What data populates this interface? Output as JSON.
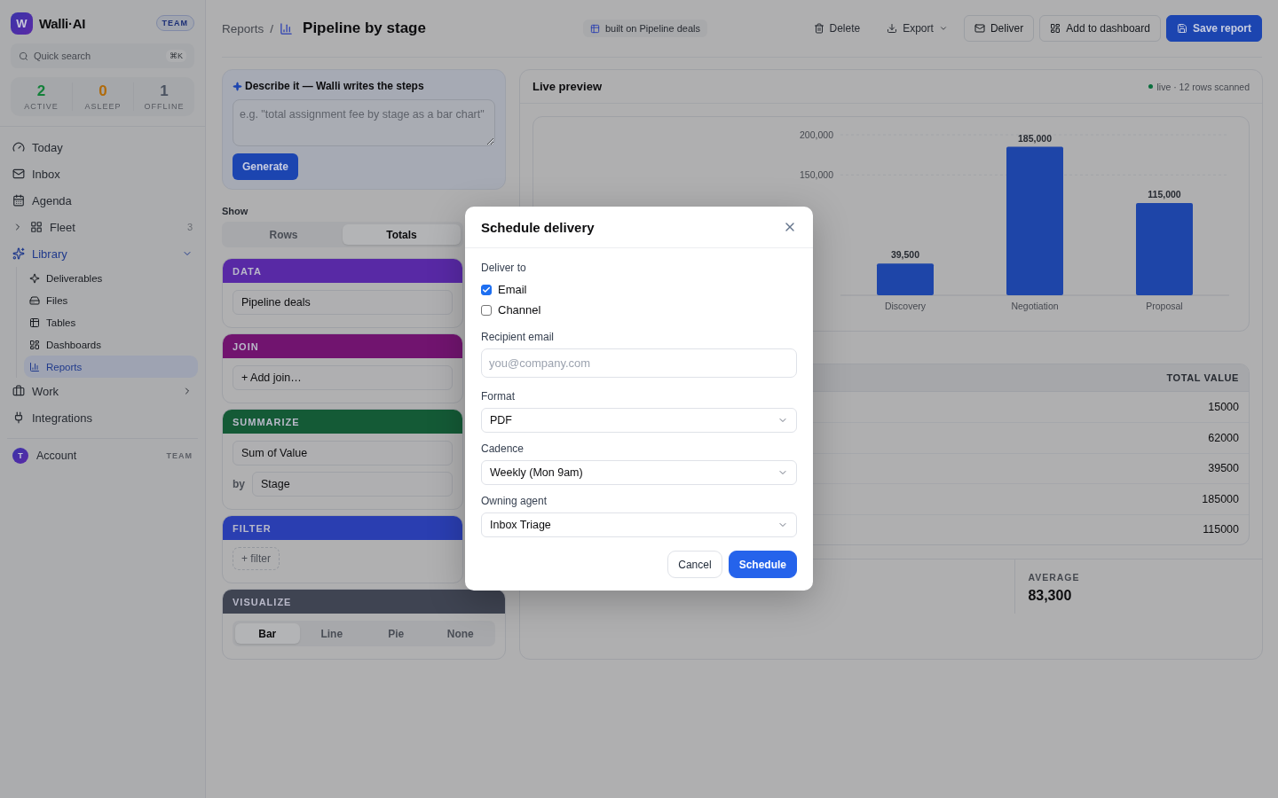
{
  "sidebar": {
    "brand": {
      "initial": "W",
      "name": "Walli·AI",
      "badge": "TEAM"
    },
    "search": {
      "placeholder": "Quick search",
      "shortcut": "⌘K"
    },
    "agent_stats": [
      {
        "value": "2",
        "label": "ACTIVE",
        "color": "#14803a"
      },
      {
        "value": "0",
        "label": "ASLEEP",
        "color": "#b06a0a"
      },
      {
        "value": "1",
        "label": "OFFLINE",
        "color": "#4a5260"
      }
    ],
    "nav": [
      {
        "label": "Today",
        "selected": false
      },
      {
        "label": "Inbox",
        "selected": false
      },
      {
        "label": "Agenda",
        "selected": false
      },
      {
        "label": "Fleet",
        "selected": false,
        "expanded": false,
        "count": "3"
      },
      {
        "label": "Library",
        "selected": true,
        "expanded": true,
        "children": [
          {
            "label": "Deliverables",
            "selected": false
          },
          {
            "label": "Files",
            "selected": false
          },
          {
            "label": "Tables",
            "selected": false
          },
          {
            "label": "Dashboards",
            "selected": false
          },
          {
            "label": "Reports",
            "selected": true
          }
        ]
      },
      {
        "label": "Work",
        "selected": false,
        "expanded": false
      },
      {
        "label": "Integrations",
        "selected": false
      }
    ],
    "account": {
      "initial": "T",
      "label": "Account",
      "badge": "TEAM"
    }
  },
  "header": {
    "breadcrumb": "Reports",
    "separator": "/",
    "title": "Pipeline by stage",
    "source_chip": "built on Pipeline deals",
    "actions": [
      {
        "label": "Delete",
        "kind": "ghost"
      },
      {
        "label": "Export",
        "kind": "menu"
      },
      {
        "label": "Deliver",
        "kind": "outline"
      },
      {
        "label": "Add to dashboard",
        "kind": "outline"
      },
      {
        "label": "Save report",
        "kind": "primary"
      }
    ]
  },
  "builder": {
    "describe": {
      "title": "Describe it — Walli writes the steps",
      "placeholder": "e.g. \"total assignment fee by stage as a bar chart\"",
      "button": "Generate"
    },
    "show": {
      "label": "Show",
      "options": [
        {
          "label": "Rows",
          "selected": false
        },
        {
          "label": "Totals",
          "selected": true
        }
      ]
    },
    "steps": [
      {
        "title": "DATA",
        "color": "#5829a5",
        "kind": "field",
        "value": "Pipeline deals"
      },
      {
        "title": "JOIN",
        "color": "#71146f",
        "kind": "field",
        "value": "+ Add join…"
      },
      {
        "title": "SUMMARIZE",
        "color": "#145a36",
        "kind": "summarize",
        "value": "Sum of Value",
        "by_label": "by",
        "by_value": "Stage"
      },
      {
        "title": "FILTER",
        "color": "#2a3eb1",
        "kind": "chip",
        "value": "+ filter"
      },
      {
        "title": "VISUALIZE",
        "color": "#3f4452",
        "kind": "segmented",
        "options": [
          {
            "label": "Bar",
            "selected": true
          },
          {
            "label": "Line",
            "selected": false
          },
          {
            "label": "Pie",
            "selected": false
          },
          {
            "label": "None",
            "selected": false
          }
        ]
      }
    ]
  },
  "preview": {
    "title": "Live preview",
    "status": "live · 12 rows scanned",
    "chart_data": {
      "type": "bar",
      "categories": [
        "Discovery",
        "Negotiation",
        "Proposal"
      ],
      "series": [
        {
          "color": "#1e45a8",
          "values": [
            39500,
            185000,
            115000
          ]
        }
      ],
      "ylim": [
        0,
        200000
      ],
      "yticks": [
        {
          "value": 150000,
          "label": "150,000"
        },
        {
          "value": 200000,
          "label": "200,000"
        }
      ],
      "value_labels": [
        "39,500",
        "185,000",
        "115,000"
      ]
    },
    "table": {
      "columns": [
        "TOTAL VALUE"
      ],
      "rows": [
        [
          "15000"
        ],
        [
          "62000"
        ],
        [
          "39500"
        ],
        [
          "185000"
        ],
        [
          "115000"
        ]
      ]
    },
    "summary": [
      {
        "label": "AVERAGE",
        "value": "83,300"
      }
    ]
  },
  "modal": {
    "title": "Schedule delivery",
    "deliver_label": "Deliver to",
    "channels": [
      {
        "label": "Email",
        "checked": true
      },
      {
        "label": "Channel",
        "checked": false
      }
    ],
    "fields": [
      {
        "label": "Recipient email",
        "kind": "input",
        "placeholder": "you@company.com"
      },
      {
        "label": "Format",
        "kind": "select",
        "value": "PDF"
      },
      {
        "label": "Cadence",
        "kind": "select",
        "value": "Weekly (Mon 9am)"
      },
      {
        "label": "Owning agent",
        "kind": "select",
        "value": "Inbox Triage"
      }
    ],
    "buttons": [
      {
        "label": "Cancel",
        "kind": "secondary"
      },
      {
        "label": "Schedule",
        "kind": "primary"
      }
    ]
  }
}
